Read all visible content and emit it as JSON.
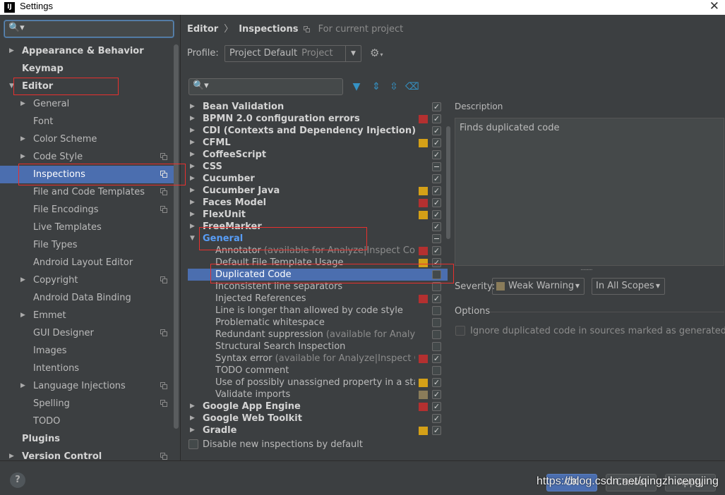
{
  "window": {
    "title": "Settings",
    "app_icon_text": "IJ",
    "close_glyph": "✕"
  },
  "left": {
    "search": {
      "glyph": "🔍▾",
      "placeholder": ""
    },
    "items": [
      {
        "label": "Appearance & Behavior",
        "level": 0,
        "bold": true,
        "arrow": "▶",
        "copy": false,
        "name": "sidebar-item-appearance-behavior"
      },
      {
        "label": "Keymap",
        "level": 0,
        "bold": true,
        "arrow": "",
        "copy": false,
        "name": "sidebar-item-keymap"
      },
      {
        "label": "Editor",
        "level": 0,
        "bold": true,
        "arrow": "▼",
        "copy": false,
        "name": "sidebar-item-editor"
      },
      {
        "label": "General",
        "level": 1,
        "bold": false,
        "arrow": "▶",
        "copy": false,
        "name": "sidebar-item-general"
      },
      {
        "label": "Font",
        "level": 1,
        "bold": false,
        "arrow": "",
        "copy": false,
        "name": "sidebar-item-font"
      },
      {
        "label": "Color Scheme",
        "level": 1,
        "bold": false,
        "arrow": "▶",
        "copy": false,
        "name": "sidebar-item-color-scheme"
      },
      {
        "label": "Code Style",
        "level": 1,
        "bold": false,
        "arrow": "▶",
        "copy": true,
        "name": "sidebar-item-code-style"
      },
      {
        "label": "Inspections",
        "level": 1,
        "bold": false,
        "arrow": "",
        "copy": true,
        "selected": true,
        "name": "sidebar-item-inspections"
      },
      {
        "label": "File and Code Templates",
        "level": 1,
        "bold": false,
        "arrow": "",
        "copy": true,
        "name": "sidebar-item-file-and-code-templates"
      },
      {
        "label": "File Encodings",
        "level": 1,
        "bold": false,
        "arrow": "",
        "copy": true,
        "name": "sidebar-item-file-encodings"
      },
      {
        "label": "Live Templates",
        "level": 1,
        "bold": false,
        "arrow": "",
        "copy": false,
        "name": "sidebar-item-live-templates"
      },
      {
        "label": "File Types",
        "level": 1,
        "bold": false,
        "arrow": "",
        "copy": false,
        "name": "sidebar-item-file-types"
      },
      {
        "label": "Android Layout Editor",
        "level": 1,
        "bold": false,
        "arrow": "",
        "copy": false,
        "name": "sidebar-item-android-layout-editor"
      },
      {
        "label": "Copyright",
        "level": 1,
        "bold": false,
        "arrow": "▶",
        "copy": true,
        "name": "sidebar-item-copyright"
      },
      {
        "label": "Android Data Binding",
        "level": 1,
        "bold": false,
        "arrow": "",
        "copy": false,
        "name": "sidebar-item-android-data-binding"
      },
      {
        "label": "Emmet",
        "level": 1,
        "bold": false,
        "arrow": "▶",
        "copy": false,
        "name": "sidebar-item-emmet"
      },
      {
        "label": "GUI Designer",
        "level": 1,
        "bold": false,
        "arrow": "",
        "copy": true,
        "name": "sidebar-item-gui-designer"
      },
      {
        "label": "Images",
        "level": 1,
        "bold": false,
        "arrow": "",
        "copy": false,
        "name": "sidebar-item-images"
      },
      {
        "label": "Intentions",
        "level": 1,
        "bold": false,
        "arrow": "",
        "copy": false,
        "name": "sidebar-item-intentions"
      },
      {
        "label": "Language Injections",
        "level": 1,
        "bold": false,
        "arrow": "▶",
        "copy": true,
        "name": "sidebar-item-language-injections"
      },
      {
        "label": "Spelling",
        "level": 1,
        "bold": false,
        "arrow": "",
        "copy": true,
        "name": "sidebar-item-spelling"
      },
      {
        "label": "TODO",
        "level": 1,
        "bold": false,
        "arrow": "",
        "copy": false,
        "name": "sidebar-item-todo"
      },
      {
        "label": "Plugins",
        "level": 0,
        "bold": true,
        "arrow": "",
        "copy": false,
        "name": "sidebar-item-plugins"
      },
      {
        "label": "Version Control",
        "level": 0,
        "bold": true,
        "arrow": "▶",
        "copy": true,
        "name": "sidebar-item-version-control"
      }
    ]
  },
  "breadcrumb": {
    "editor": "Editor",
    "separator": "〉",
    "inspections": "Inspections",
    "for_project": "For current project"
  },
  "profile": {
    "label": "Profile:",
    "value": "Project Default",
    "sub": "Project",
    "dropdown_glyph": "▼",
    "gear_glyph": "⚙",
    "gear_arrow": "▾"
  },
  "toolbar": {
    "search_glyph": "🔍▾",
    "filter_glyph": "▼",
    "expand_glyph": "⇕",
    "collapse_glyph": "⇳",
    "reset_glyph": "⌫"
  },
  "colors": {
    "error": "#b33030",
    "warning": "#d4a017",
    "weak_warning": "#8a7c5a",
    "selection": "#4b6eaf",
    "link_blue": "#589df6"
  },
  "inspections": [
    {
      "label": "Bean Validation",
      "type": "group",
      "arrow": "▶",
      "severity": "",
      "checked": "check"
    },
    {
      "label": "BPMN 2.0 configuration errors",
      "type": "group",
      "arrow": "▶",
      "severity": "error",
      "checked": "check"
    },
    {
      "label": "CDI (Contexts and Dependency Injection)",
      "type": "group",
      "arrow": "▶",
      "severity": "",
      "checked": "check"
    },
    {
      "label": "CFML",
      "type": "group",
      "arrow": "▶",
      "severity": "warning",
      "checked": "check"
    },
    {
      "label": "CoffeeScript",
      "type": "group",
      "arrow": "▶",
      "severity": "",
      "checked": "check"
    },
    {
      "label": "CSS",
      "type": "group",
      "arrow": "▶",
      "severity": "",
      "checked": "dash"
    },
    {
      "label": "Cucumber",
      "type": "group",
      "arrow": "▶",
      "severity": "",
      "checked": "check"
    },
    {
      "label": "Cucumber Java",
      "type": "group",
      "arrow": "▶",
      "severity": "warning",
      "checked": "check"
    },
    {
      "label": "Faces Model",
      "type": "group",
      "arrow": "▶",
      "severity": "error",
      "checked": "check"
    },
    {
      "label": "FlexUnit",
      "type": "group",
      "arrow": "▶",
      "severity": "warning",
      "checked": "check"
    },
    {
      "label": "FreeMarker",
      "type": "group",
      "arrow": "▶",
      "severity": "",
      "checked": "check"
    },
    {
      "label": "General",
      "type": "group",
      "arrow": "▼",
      "severity": "",
      "checked": "dash",
      "general": true
    },
    {
      "label": "Annotator",
      "hint": " (available for Analyze|Inspect Code)",
      "type": "item",
      "severity": "error",
      "checked": "check"
    },
    {
      "label": "Default File Template Usage",
      "type": "item",
      "severity": "warning",
      "checked": "check"
    },
    {
      "label": "Duplicated Code",
      "type": "item",
      "severity": "",
      "checked": "none",
      "selected": true
    },
    {
      "label": "Inconsistent line separators",
      "type": "item",
      "severity": "",
      "checked": "none"
    },
    {
      "label": "Injected References",
      "type": "item",
      "severity": "error",
      "checked": "check"
    },
    {
      "label": "Line is longer than allowed by code style",
      "type": "item",
      "severity": "",
      "checked": "none"
    },
    {
      "label": "Problematic whitespace",
      "type": "item",
      "severity": "",
      "checked": "none"
    },
    {
      "label": "Redundant suppression",
      "hint": " (available for Analyze|Insp",
      "type": "item",
      "severity": "",
      "checked": "none"
    },
    {
      "label": "Structural Search Inspection",
      "type": "item",
      "severity": "",
      "checked": "none"
    },
    {
      "label": "Syntax error",
      "hint": " (available for Analyze|Inspect Code)",
      "type": "item",
      "severity": "error",
      "checked": "check"
    },
    {
      "label": "TODO comment",
      "type": "item",
      "severity": "",
      "checked": "none"
    },
    {
      "label": "Use of possibly unassigned property in a static ir",
      "type": "item",
      "severity": "warning",
      "checked": "check"
    },
    {
      "label": "Validate imports",
      "type": "item",
      "severity": "weak_warning",
      "checked": "check"
    },
    {
      "label": "Google App Engine",
      "type": "group",
      "arrow": "▶",
      "severity": "error",
      "checked": "check"
    },
    {
      "label": "Google Web Toolkit",
      "type": "group",
      "arrow": "▶",
      "severity": "",
      "checked": "check"
    },
    {
      "label": "Gradle",
      "type": "group",
      "arrow": "▶",
      "severity": "warning",
      "checked": "check"
    }
  ],
  "disable_new": {
    "label": "Disable new inspections by default"
  },
  "description": {
    "title": "Description",
    "text": "Finds duplicated code",
    "grip": "........."
  },
  "severity": {
    "label": "Severity:",
    "value": "Weak Warning",
    "dropdown_glyph": "▼"
  },
  "scope": {
    "value": "In All Scopes",
    "dropdown_glyph": "▼"
  },
  "options": {
    "label": "Options",
    "ignore_label": "Ignore duplicated code in sources marked as generated"
  },
  "buttons": {
    "help": "?",
    "ok": "OK",
    "cancel": "Cancel",
    "apply": "Apply"
  },
  "watermark": "https://blog.csdn.net/qingzhicengjing"
}
